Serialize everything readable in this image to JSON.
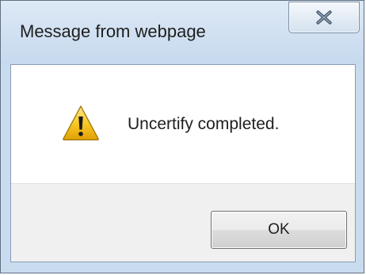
{
  "dialog": {
    "title": "Message from webpage",
    "message": "Uncertify completed.",
    "close_icon": "close-x-icon",
    "message_icon": "warning-icon",
    "ok_label": "OK"
  },
  "colors": {
    "titlebar": "#c9dcef",
    "content_bg": "#ffffff",
    "button_area_bg": "#f0f0f0",
    "warning_yellow": "#f5c31a",
    "close_x": "#5a6e85"
  }
}
